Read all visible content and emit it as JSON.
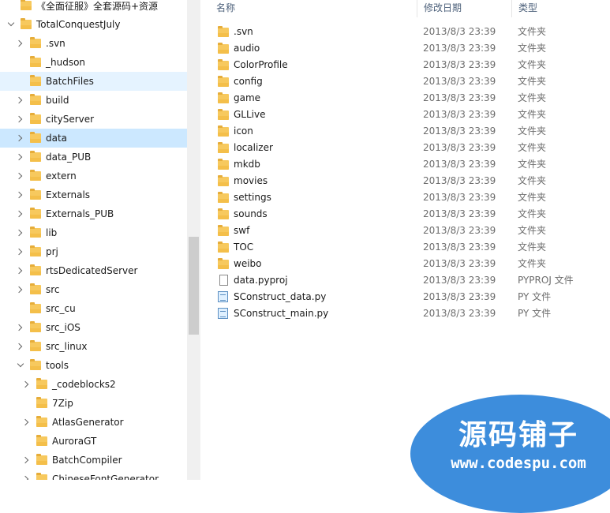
{
  "nav": {
    "items": [
      {
        "label": "《全面征服》全套源码+资源",
        "chevron": "none",
        "level": 1
      },
      {
        "label": "TotalConquestJuly",
        "chevron": "down",
        "level": 1
      },
      {
        "label": ".svn",
        "chevron": "right",
        "level": 2
      },
      {
        "label": "_hudson",
        "chevron": "none",
        "level": 2
      },
      {
        "label": "BatchFiles",
        "chevron": "none",
        "level": 2,
        "state": "hover"
      },
      {
        "label": "build",
        "chevron": "right",
        "level": 2
      },
      {
        "label": "cityServer",
        "chevron": "right",
        "level": 2
      },
      {
        "label": "data",
        "chevron": "right",
        "level": 2,
        "state": "selected"
      },
      {
        "label": "data_PUB",
        "chevron": "right",
        "level": 2
      },
      {
        "label": "extern",
        "chevron": "right",
        "level": 2
      },
      {
        "label": "Externals",
        "chevron": "right",
        "level": 2
      },
      {
        "label": "Externals_PUB",
        "chevron": "right",
        "level": 2
      },
      {
        "label": "lib",
        "chevron": "right",
        "level": 2
      },
      {
        "label": "prj",
        "chevron": "right",
        "level": 2
      },
      {
        "label": "rtsDedicatedServer",
        "chevron": "right",
        "level": 2
      },
      {
        "label": "src",
        "chevron": "right",
        "level": 2
      },
      {
        "label": "src_cu",
        "chevron": "none",
        "level": 2
      },
      {
        "label": "src_iOS",
        "chevron": "right",
        "level": 2
      },
      {
        "label": "src_linux",
        "chevron": "right",
        "level": 2
      },
      {
        "label": "tools",
        "chevron": "down",
        "level": 2
      },
      {
        "label": "_codeblocks2",
        "chevron": "right",
        "level": 3
      },
      {
        "label": "7Zip",
        "chevron": "none",
        "level": 3
      },
      {
        "label": "AtlasGenerator",
        "chevron": "right",
        "level": 3
      },
      {
        "label": "AuroraGT",
        "chevron": "none",
        "level": 3
      },
      {
        "label": "BatchCompiler",
        "chevron": "right",
        "level": 3
      },
      {
        "label": "ChineseFontGenerator",
        "chevron": "right",
        "level": 3
      }
    ]
  },
  "columns": {
    "name": "名称",
    "date": "修改日期",
    "type": "类型"
  },
  "files": [
    {
      "name": ".svn",
      "date": "2013/8/3 23:39",
      "type": "文件夹",
      "icon": "folder"
    },
    {
      "name": "audio",
      "date": "2013/8/3 23:39",
      "type": "文件夹",
      "icon": "folder"
    },
    {
      "name": "ColorProfile",
      "date": "2013/8/3 23:39",
      "type": "文件夹",
      "icon": "folder"
    },
    {
      "name": "config",
      "date": "2013/8/3 23:39",
      "type": "文件夹",
      "icon": "folder"
    },
    {
      "name": "game",
      "date": "2013/8/3 23:39",
      "type": "文件夹",
      "icon": "folder"
    },
    {
      "name": "GLLive",
      "date": "2013/8/3 23:39",
      "type": "文件夹",
      "icon": "folder"
    },
    {
      "name": "icon",
      "date": "2013/8/3 23:39",
      "type": "文件夹",
      "icon": "folder"
    },
    {
      "name": "localizer",
      "date": "2013/8/3 23:39",
      "type": "文件夹",
      "icon": "folder"
    },
    {
      "name": "mkdb",
      "date": "2013/8/3 23:39",
      "type": "文件夹",
      "icon": "folder"
    },
    {
      "name": "movies",
      "date": "2013/8/3 23:39",
      "type": "文件夹",
      "icon": "folder"
    },
    {
      "name": "settings",
      "date": "2013/8/3 23:39",
      "type": "文件夹",
      "icon": "folder"
    },
    {
      "name": "sounds",
      "date": "2013/8/3 23:39",
      "type": "文件夹",
      "icon": "folder"
    },
    {
      "name": "swf",
      "date": "2013/8/3 23:39",
      "type": "文件夹",
      "icon": "folder"
    },
    {
      "name": "TOC",
      "date": "2013/8/3 23:39",
      "type": "文件夹",
      "icon": "folder"
    },
    {
      "name": "weibo",
      "date": "2013/8/3 23:39",
      "type": "文件夹",
      "icon": "folder"
    },
    {
      "name": "data.pyproj",
      "date": "2013/8/3 23:39",
      "type": "PYPROJ 文件",
      "icon": "document"
    },
    {
      "name": "SConstruct_data.py",
      "date": "2013/8/3 23:39",
      "type": "PY 文件",
      "icon": "python-file"
    },
    {
      "name": "SConstruct_main.py",
      "date": "2013/8/3 23:39",
      "type": "PY 文件",
      "icon": "python-file"
    }
  ],
  "watermark": {
    "title": "源码铺子",
    "url": "www.codespu.com",
    "color": "#3d8ddc"
  }
}
